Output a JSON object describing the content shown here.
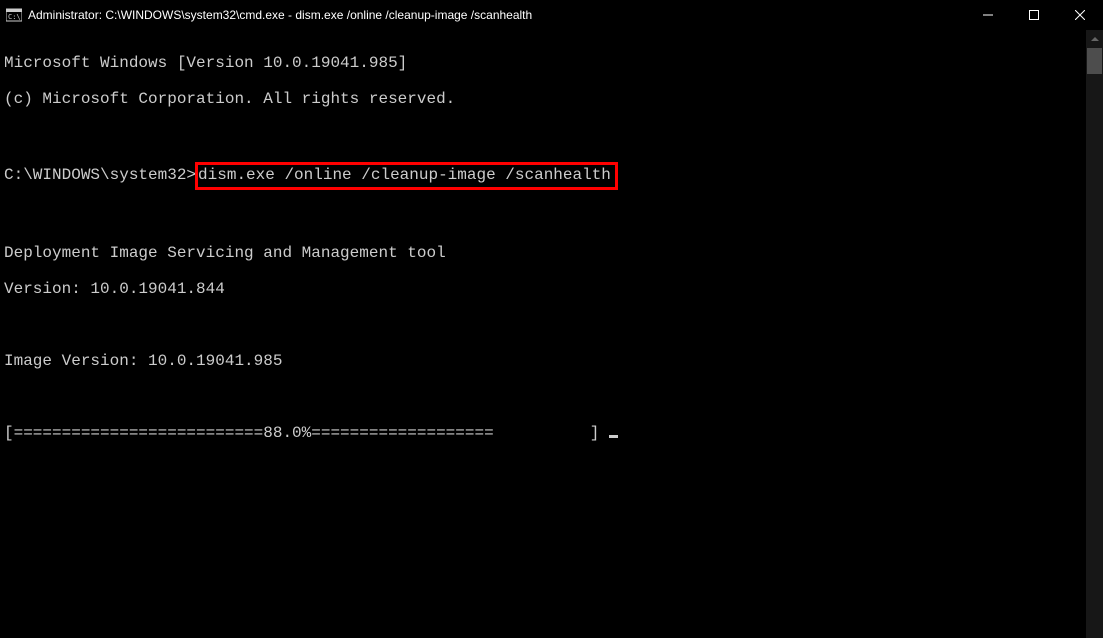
{
  "titlebar": {
    "text": "Administrator: C:\\WINDOWS\\system32\\cmd.exe - dism.exe  /online /cleanup-image /scanhealth"
  },
  "terminal": {
    "line1": "Microsoft Windows [Version 10.0.19041.985]",
    "line2": "(c) Microsoft Corporation. All rights reserved.",
    "blank1": "",
    "prompt": "C:\\WINDOWS\\system32>",
    "command": "dism.exe /online /cleanup-image /scanhealth",
    "blank2": "",
    "tool_line": "Deployment Image Servicing and Management tool",
    "version_line": "Version: 10.0.19041.844",
    "blank3": "",
    "image_version": "Image Version: 10.0.19041.985",
    "blank4": "",
    "progress": "[==========================88.0%===================          ] "
  }
}
